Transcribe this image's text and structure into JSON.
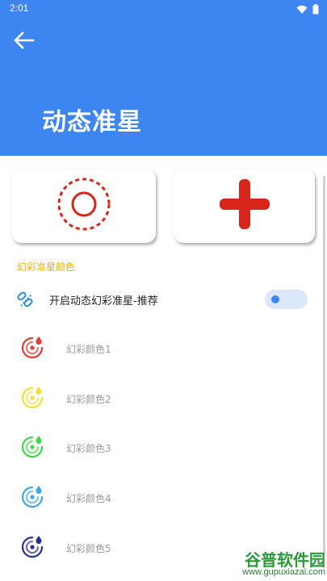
{
  "status_bar": {
    "time": "2:01"
  },
  "header": {
    "title": "动态准星"
  },
  "section": {
    "title": "幻彩准星颜色"
  },
  "toggle": {
    "label": "开启动态幻彩准星-推荐",
    "enabled": false
  },
  "colors": [
    {
      "label": "幻彩颜色1",
      "color": "#e43a2f"
    },
    {
      "label": "幻彩颜色2",
      "color": "#f2df3a"
    },
    {
      "label": "幻彩颜色3",
      "color": "#3fd84a"
    },
    {
      "label": "幻彩颜色4",
      "color": "#3ba7e6"
    },
    {
      "label": "幻彩颜色5",
      "color": "#2a2f8f"
    }
  ],
  "watermark": {
    "brand": "谷普软件园",
    "url": "www.gupuxiazai.com"
  },
  "theme": {
    "accent": "#3d86f2",
    "section_color": "#f5b400",
    "crosshair_red": "#d8251c"
  }
}
